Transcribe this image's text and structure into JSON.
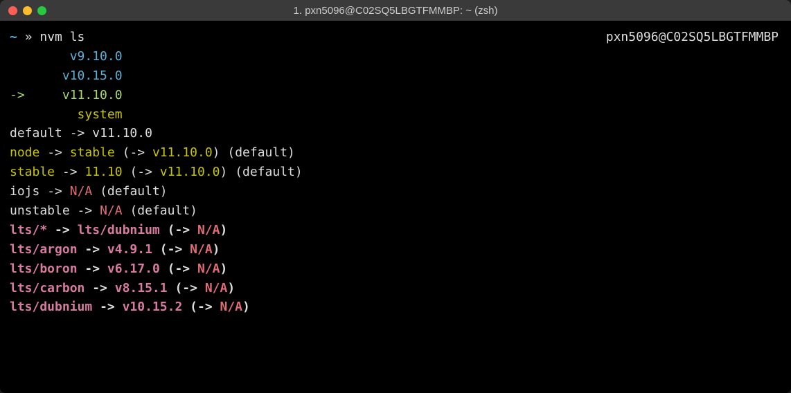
{
  "window": {
    "title": "1. pxn5096@C02SQ5LBGTFMMBP: ~ (zsh)"
  },
  "prompt": {
    "tilde": "~",
    "arrow": "»",
    "command": "nvm ls",
    "host_right": "pxn5096@C02SQ5LBGTFMMBP"
  },
  "versions": {
    "v0": "v9.10.0",
    "v1": "v10.15.0",
    "arrow": "->",
    "v2_current": "v11.10.0",
    "system": "system"
  },
  "aliases": {
    "default": {
      "label": "default",
      "arrow": "->",
      "target": "v11.10.0"
    },
    "node": {
      "label": "node",
      "arrow": "->",
      "target": "stable",
      "resolved_open": "(->",
      "resolved": "v11.10.0",
      "resolved_close": ")",
      "note": "(default)"
    },
    "stable": {
      "label": "stable",
      "arrow": "->",
      "target": "11.10",
      "resolved_open": "(->",
      "resolved": "v11.10.0",
      "resolved_close": ")",
      "note": "(default)"
    },
    "iojs": {
      "label": "iojs",
      "arrow": "->",
      "target": "N/A",
      "note": "(default)"
    },
    "unstable": {
      "label": "unstable",
      "arrow": "->",
      "target": "N/A",
      "note": "(default)"
    }
  },
  "lts": {
    "star": {
      "label": "lts/*",
      "arrow": "->",
      "target": "lts/dubnium",
      "resolved_open": "(->",
      "resolved": "N/A",
      "resolved_close": ")"
    },
    "argon": {
      "label": "lts/argon",
      "arrow": "->",
      "target": "v4.9.1",
      "resolved_open": "(->",
      "resolved": "N/A",
      "resolved_close": ")"
    },
    "boron": {
      "label": "lts/boron",
      "arrow": "->",
      "target": "v6.17.0",
      "resolved_open": "(->",
      "resolved": "N/A",
      "resolved_close": ")"
    },
    "carbon": {
      "label": "lts/carbon",
      "arrow": "->",
      "target": "v8.15.1",
      "resolved_open": "(->",
      "resolved": "N/A",
      "resolved_close": ")"
    },
    "dubnium": {
      "label": "lts/dubnium",
      "arrow": "->",
      "target": "v10.15.2",
      "resolved_open": "(->",
      "resolved": "N/A",
      "resolved_close": ")"
    }
  }
}
